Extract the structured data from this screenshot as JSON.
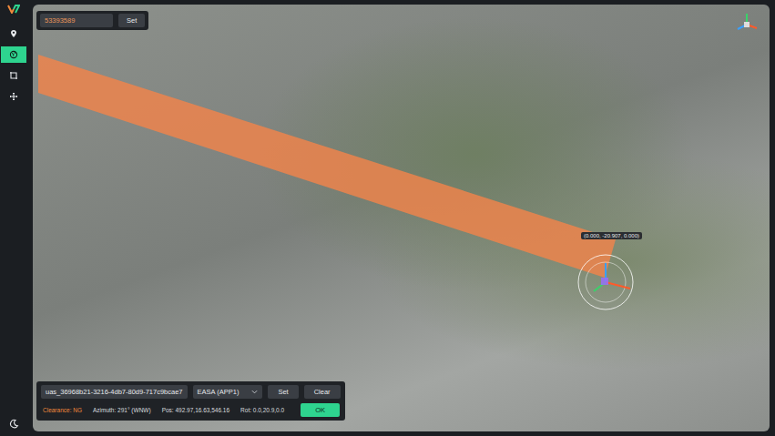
{
  "entity_search": {
    "value": "53393589",
    "button": "Set"
  },
  "sidebar": {
    "items": [
      {
        "selected": false
      },
      {
        "selected": true
      },
      {
        "selected": false
      },
      {
        "selected": false
      }
    ]
  },
  "map": {
    "gizmo_label": "(0.000, -20.907, 0.000)"
  },
  "control_panel": {
    "uas_id": "uas_36968b21-3216-4db7-80d9-717c9bcae7",
    "dropdown": "EASA (APP1)",
    "buttons": [
      "Set",
      "Clear"
    ],
    "clearance": {
      "label": "Clearance: NG",
      "ok": false
    },
    "azimuth": "Azimuth: 291° (WNW)",
    "pos": "Pos: 492.97,16.63,546.16",
    "rot": "Rot: 0.0,20.9,0.0",
    "ok_button": {
      "label": "OK",
      "disabled": false
    }
  }
}
